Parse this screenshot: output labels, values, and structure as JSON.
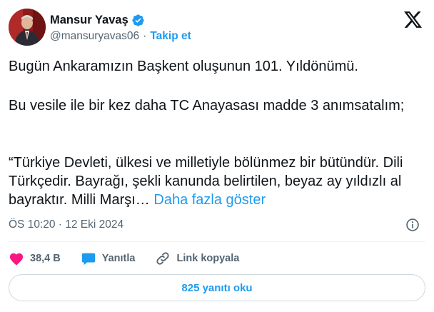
{
  "author": {
    "name": "Mansur Yavaş",
    "handle": "@mansuryavas06",
    "separator": "·",
    "follow_label": "Takip et"
  },
  "post": {
    "paragraph_1": "Bugün Ankaramızın Başkent oluşunun 101. Yıldönümü.",
    "paragraph_2": "Bu vesile ile bir kez daha TC Anayasası madde 3 anımsatalım;",
    "paragraph_3": "“Türkiye Devleti, ülkesi ve milletiyle bölünmez bir bütündür. Dili Türkçedir. Bayrağı, şekli kanunda belirtilen, beyaz ay yıldızlı al bayraktır. Milli Marşı…",
    "show_more_label": "Daha fazla göster"
  },
  "meta": {
    "timestamp": "ÖS 10:20 · 12 Eki 2024"
  },
  "actions": {
    "like_count": "38,4 B",
    "reply_label": "Yanıtla",
    "copy_link_label": "Link kopyala"
  },
  "replies_button_label": "825 yanıtı oku",
  "icons": {
    "verified": "verified-badge-icon",
    "logo": "x-logo-icon",
    "info": "info-icon",
    "like": "heart-icon",
    "reply": "speech-bubble-icon",
    "link": "link-icon"
  },
  "colors": {
    "accent": "#1d9bf0",
    "like": "#f91880",
    "text": "#0f1419",
    "secondary": "#536471"
  }
}
